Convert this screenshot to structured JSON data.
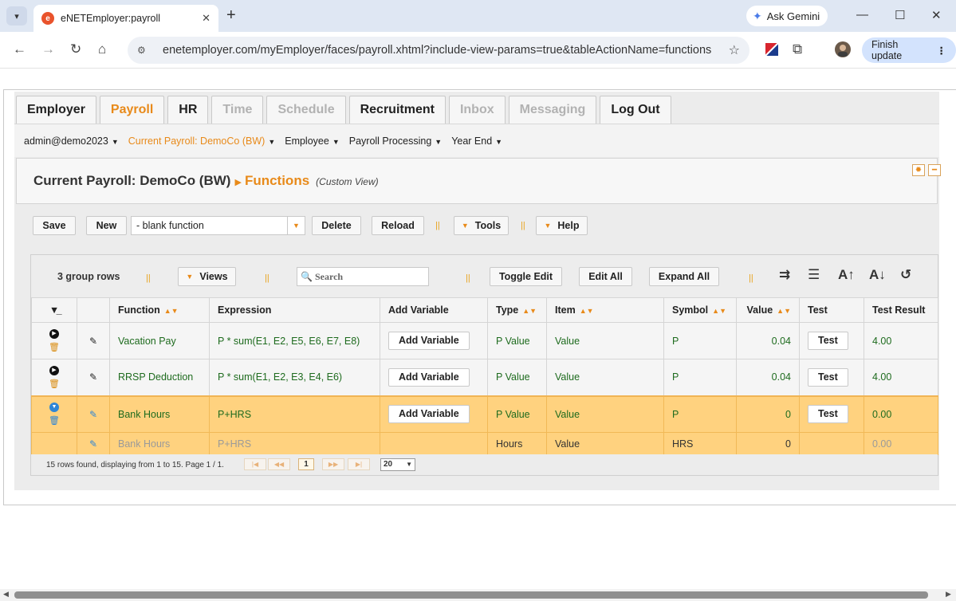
{
  "browser": {
    "tab_title": "eNETEmployer:payroll",
    "favicon_letter": "e",
    "url": "enetemployer.com/myEmployer/faces/payroll.xhtml?include-view-params=true&tableActionName=functions",
    "gemini_label": "Ask Gemini",
    "finish_update_label": "Finish update"
  },
  "main_tabs": [
    {
      "label": "Employer",
      "state": "normal"
    },
    {
      "label": "Payroll",
      "state": "active"
    },
    {
      "label": "HR",
      "state": "normal"
    },
    {
      "label": "Time",
      "state": "disabled"
    },
    {
      "label": "Schedule",
      "state": "disabled"
    },
    {
      "label": "Recruitment",
      "state": "normal"
    },
    {
      "label": "Inbox",
      "state": "disabled"
    },
    {
      "label": "Messaging",
      "state": "disabled"
    },
    {
      "label": "Log Out",
      "state": "normal"
    }
  ],
  "subnav": {
    "user": "admin@demo2023",
    "current_payroll": "Current Payroll: DemoCo (BW)",
    "employee": "Employee",
    "payroll_processing": "Payroll Processing",
    "year_end": "Year End"
  },
  "title": {
    "main": "Current Payroll: DemoCo (BW)",
    "section": "Functions",
    "view": "(Custom View)"
  },
  "toolbar": {
    "save": "Save",
    "new": "New",
    "function_select": "- blank function",
    "delete": "Delete",
    "reload": "Reload",
    "tools": "Tools",
    "help": "Help"
  },
  "grid_toolbar": {
    "group_rows": "3 group rows",
    "views": "Views",
    "search_placeholder": "Search",
    "toggle_edit": "Toggle Edit",
    "edit_all": "Edit All",
    "expand_all": "Expand All"
  },
  "columns": {
    "function": "Function",
    "expression": "Expression",
    "add_variable": "Add Variable",
    "type": "Type",
    "item": "Item",
    "symbol": "Symbol",
    "value": "Value",
    "test": "Test",
    "test_result": "Test Result"
  },
  "rows": [
    {
      "function": "Vacation Pay",
      "expression": "P * sum(E1, E2, E5, E6, E7, E8)",
      "add_variable": "Add Variable",
      "type": "P Value",
      "item": "Value",
      "symbol": "P",
      "value": "0.04",
      "test": "Test",
      "test_result": "4.00"
    },
    {
      "function": "RRSP Deduction",
      "expression": "P * sum(E1, E2, E3, E4, E6)",
      "add_variable": "Add Variable",
      "type": "P Value",
      "item": "Value",
      "symbol": "P",
      "value": "0.04",
      "test": "Test",
      "test_result": "4.00"
    },
    {
      "function": "Bank Hours",
      "expression": "P+HRS",
      "add_variable": "Add Variable",
      "type": "P Value",
      "item": "Value",
      "symbol": "P",
      "value": "0",
      "test": "Test",
      "test_result": "0.00"
    },
    {
      "function": "Bank Hours",
      "expression": "P+HRS",
      "type": "Hours",
      "item": "Value",
      "symbol": "HRS",
      "value": "0",
      "test_result": "0.00"
    }
  ],
  "pager": {
    "summary": "15 rows found, displaying from 1 to 15. Page 1 / 1.",
    "current_page": "1",
    "page_size": "20"
  },
  "icons": {
    "sort": "sort-updown-icon",
    "filter": "filter-icon",
    "wrap": "wrap-text-icon",
    "clear": "clear-filter-icon",
    "font_up": "font-increase-icon",
    "font_down": "font-decrease-icon",
    "reset": "reset-icon"
  },
  "colors": {
    "accent": "#e88a1a",
    "selected_row": "#ffd27f",
    "cell_text": "#1e6b1e"
  }
}
